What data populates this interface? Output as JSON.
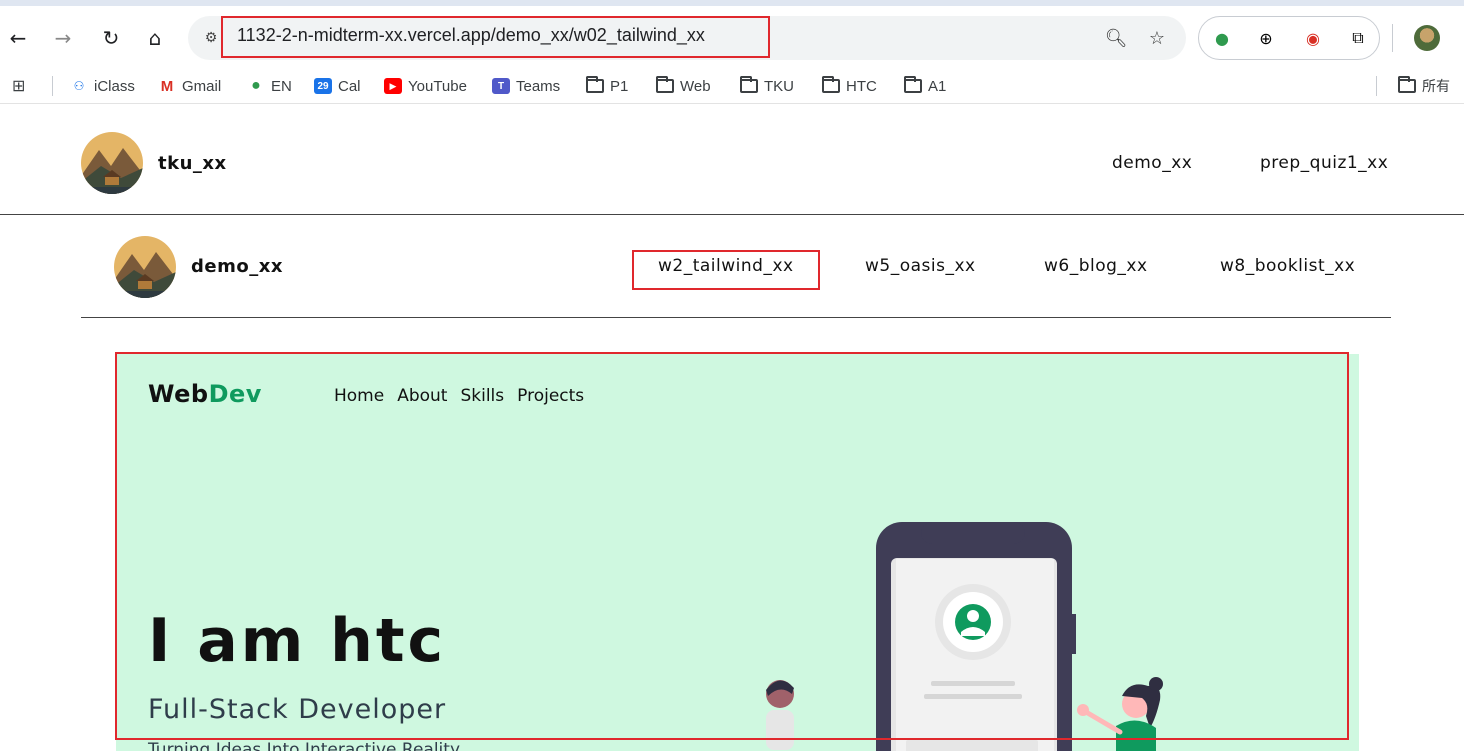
{
  "browser": {
    "url": "1132-2-n-midterm-xx.vercel.app/demo_xx/w02_tailwind_xx",
    "bookmarks": [
      {
        "label": "iClass",
        "icon": "iclass-icon"
      },
      {
        "label": "Gmail",
        "icon": "gmail-icon"
      },
      {
        "label": "EN",
        "icon": "evernote-icon"
      },
      {
        "label": "Cal",
        "icon": "calendar-icon",
        "badge": "29"
      },
      {
        "label": "YouTube",
        "icon": "youtube-icon"
      },
      {
        "label": "Teams",
        "icon": "teams-icon"
      },
      {
        "label": "P1",
        "icon": "folder-icon"
      },
      {
        "label": "Web",
        "icon": "folder-icon"
      },
      {
        "label": "TKU",
        "icon": "folder-icon"
      },
      {
        "label": "HTC",
        "icon": "folder-icon"
      },
      {
        "label": "A1",
        "icon": "folder-icon"
      }
    ],
    "other_bookmarks_label": "所有"
  },
  "site": {
    "top_brand": "tku_xx",
    "top_links": [
      "demo_xx",
      "prep_quiz1_xx"
    ],
    "sub_brand": "demo_xx",
    "sub_links": [
      "w2_tailwind_xx",
      "w5_oasis_xx",
      "w6_blog_xx",
      "w8_booklist_xx"
    ],
    "active_sub_link": "w2_tailwind_xx"
  },
  "hero": {
    "logo_main": "Web",
    "logo_accent": "Dev",
    "nav": [
      "Home",
      "About",
      "Skills",
      "Projects"
    ],
    "title": "I am htc",
    "subtitle": "Full-Stack Developer",
    "tagline": "Turning Ideas Into Interactive Reality",
    "bg_color": "#cff8e0",
    "accent_color": "#0f9a5e"
  }
}
